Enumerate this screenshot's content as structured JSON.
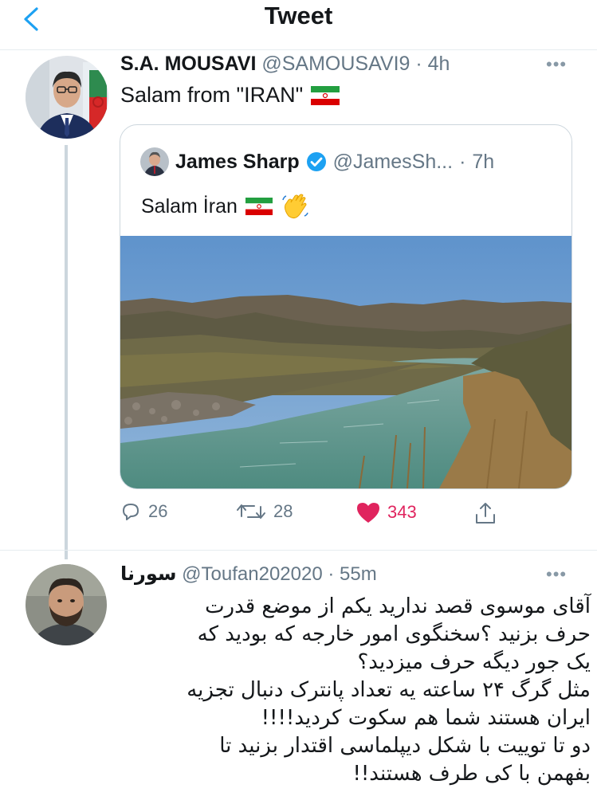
{
  "header": {
    "title": "Tweet",
    "back_icon": "chevron-left-icon",
    "accent": "#1da1f2"
  },
  "main_tweet": {
    "name": "S.A. MOUSAVI",
    "handle": "@SAMOUSAVI9",
    "time": "4h",
    "text": "Salam from \"IRAN\"",
    "flag_icon": "iran-flag-icon",
    "quoted": {
      "name": "James Sharp",
      "verified_icon": "verified-badge-icon",
      "handle": "@JamesSh...",
      "time": "7h",
      "text": "Salam İran",
      "flag_icon": "iran-flag-icon",
      "emoji_icon": "waving-hand-icon"
    },
    "actions": {
      "replies": "26",
      "retweets": "28",
      "likes": "343",
      "like_color": "#e0245e"
    }
  },
  "reply": {
    "name": "سورنا",
    "handle": "@Toufan202020",
    "time": "55m",
    "text": "آقای موسوی قصد ندارید یکم از موضع قدرت\nحرف بزنید ؟سخنگوی امور خارجه که بودید که\nیک جور دیگه حرف میزدید؟\nمثل گرگ ۲۴ ساعته  یه تعداد پانترک دنبال تجزیه\nایران هستند شما هم سکوت کردید!!!!\nدو تا توییت با شکل دیپلماسی اقتدار بزنید تا\nبفهمن با کی طرف هستند!!"
  }
}
